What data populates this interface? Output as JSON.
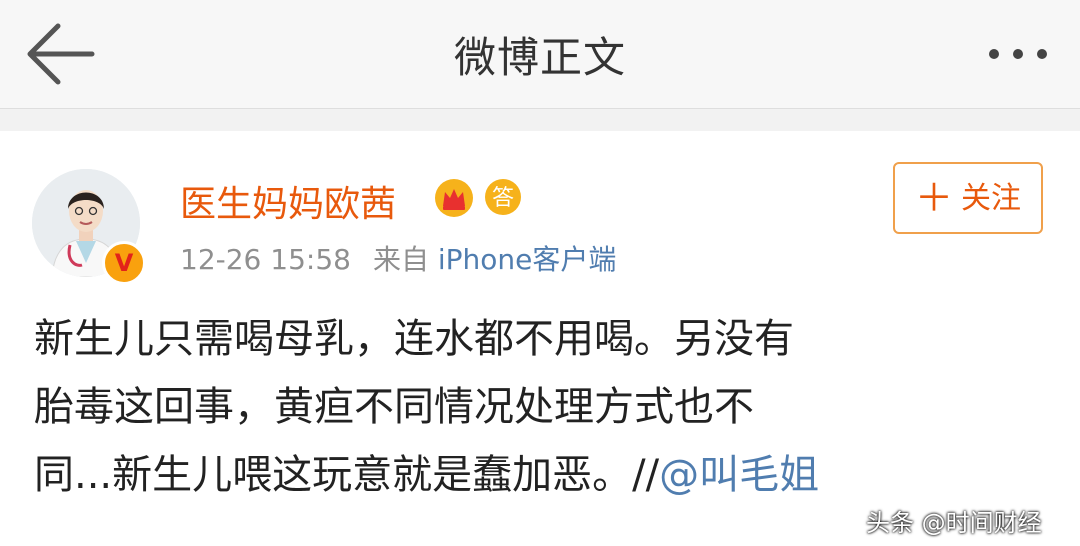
{
  "navbar": {
    "title": "微博正文"
  },
  "post": {
    "author": "医生妈妈欧茜",
    "verified_badge": "V",
    "timestamp": "12-26 15:58",
    "source_prefix": "来自",
    "source_device": "iPhone客户端",
    "follow_plus": "＋",
    "follow_label": "关注",
    "text_line1": "新生儿只需喝母乳，连水都不用喝。另没有",
    "text_line2": "胎毒这回事，黄疸不同情况处理方式也不",
    "text_line3": "同...新生儿喂这玩意就是蠢加恶。//",
    "mention": "@叫毛姐"
  },
  "watermark": "头条 @时间财经",
  "icons": {
    "back": "arrow-left-icon",
    "more": "more-horizontal-icon",
    "crown": "crown-member-icon",
    "answer": "answer-badge-icon"
  },
  "colors": {
    "username": "#e8590c",
    "link": "#507daf",
    "follow_border": "#f0a04b",
    "meta": "#8f8f8f"
  }
}
